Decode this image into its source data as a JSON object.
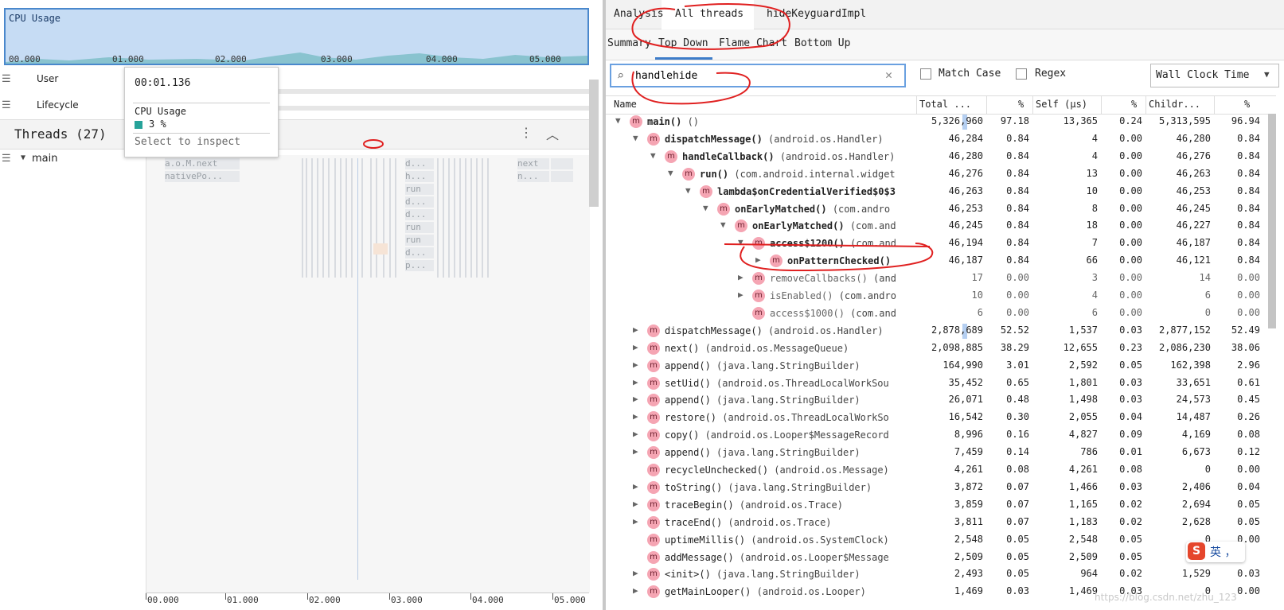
{
  "cpu": {
    "title": "CPU Usage",
    "ticks": [
      "00.000",
      "01.000",
      "02.000",
      "03.000",
      "04.000",
      "05.000"
    ]
  },
  "left_rows": {
    "user": "User",
    "lifecycle": "Lifecycle"
  },
  "threads": {
    "title": "Threads (27)",
    "main_label": "main"
  },
  "tooltip": {
    "time": "00:01.136",
    "label": "CPU Usage",
    "value": "3 %",
    "hint": "Select to inspect"
  },
  "flame": {
    "col1": [
      "a.o.M.next",
      "nativePo..."
    ],
    "col2": [
      "d...",
      "h...",
      "run",
      "d...",
      "d...",
      "run",
      "run",
      "d...",
      "p..."
    ],
    "col3": [
      "next",
      "n..."
    ]
  },
  "ruler": [
    "00.000",
    "01.000",
    "02.000",
    "03.000",
    "04.000",
    "05.000"
  ],
  "tabs": [
    "Analysis",
    "All threads",
    "hideKeyguardImpl"
  ],
  "subtabs": [
    "Summary",
    "Top Down",
    "Flame Chart",
    "Bottom Up"
  ],
  "search": {
    "value": "handlehide"
  },
  "options": {
    "match_case": "Match Case",
    "regex": "Regex",
    "clock": "Wall Clock Time"
  },
  "columns": [
    "Name",
    "Total ...",
    "%",
    "Self (μs)",
    "%",
    "Childr...",
    "%"
  ],
  "rows": [
    {
      "depth": 0,
      "arrow": "down",
      "name": "main()",
      "cls": "()",
      "total": "5,326,960",
      "tp": "97.18",
      "self": "13,365",
      "sp": "0.24",
      "child": "5,313,595",
      "cp": "96.94",
      "bold": true
    },
    {
      "depth": 1,
      "arrow": "down",
      "name": "dispatchMessage()",
      "cls": "(android.os.Handler)",
      "total": "46,284",
      "tp": "0.84",
      "self": "4",
      "sp": "0.00",
      "child": "46,280",
      "cp": "0.84",
      "bold": true
    },
    {
      "depth": 2,
      "arrow": "down",
      "name": "handleCallback()",
      "cls": "(android.os.Handler)",
      "total": "46,280",
      "tp": "0.84",
      "self": "4",
      "sp": "0.00",
      "child": "46,276",
      "cp": "0.84",
      "bold": true
    },
    {
      "depth": 3,
      "arrow": "down",
      "name": "run()",
      "cls": "(com.android.internal.widget",
      "total": "46,276",
      "tp": "0.84",
      "self": "13",
      "sp": "0.00",
      "child": "46,263",
      "cp": "0.84",
      "bold": true
    },
    {
      "depth": 4,
      "arrow": "down",
      "name": "lambda$onCredentialVerified$0$3",
      "cls": "",
      "total": "46,263",
      "tp": "0.84",
      "self": "10",
      "sp": "0.00",
      "child": "46,253",
      "cp": "0.84",
      "bold": true
    },
    {
      "depth": 5,
      "arrow": "down",
      "name": "onEarlyMatched()",
      "cls": "(com.andro",
      "total": "46,253",
      "tp": "0.84",
      "self": "8",
      "sp": "0.00",
      "child": "46,245",
      "cp": "0.84",
      "bold": true
    },
    {
      "depth": 6,
      "arrow": "down",
      "name": "onEarlyMatched()",
      "cls": "(com.and",
      "total": "46,245",
      "tp": "0.84",
      "self": "18",
      "sp": "0.00",
      "child": "46,227",
      "cp": "0.84",
      "bold": true
    },
    {
      "depth": 7,
      "arrow": "down",
      "name": "access$1200()",
      "cls": "(com.and",
      "total": "46,194",
      "tp": "0.84",
      "self": "7",
      "sp": "0.00",
      "child": "46,187",
      "cp": "0.84",
      "bold": true
    },
    {
      "depth": 8,
      "arrow": "right",
      "name": "onPatternChecked()",
      "cls": "",
      "total": "46,187",
      "tp": "0.84",
      "self": "66",
      "sp": "0.00",
      "child": "46,121",
      "cp": "0.84",
      "bold": true
    },
    {
      "depth": 7,
      "arrow": "right",
      "name": "removeCallbacks()",
      "cls": "(and",
      "total": "17",
      "tp": "0.00",
      "self": "3",
      "sp": "0.00",
      "child": "14",
      "cp": "0.00",
      "dim": true
    },
    {
      "depth": 7,
      "arrow": "right",
      "name": "isEnabled()",
      "cls": "(com.andro",
      "total": "10",
      "tp": "0.00",
      "self": "4",
      "sp": "0.00",
      "child": "6",
      "cp": "0.00",
      "dim": true
    },
    {
      "depth": 7,
      "arrow": "none",
      "name": "access$1000()",
      "cls": "(com.and",
      "total": "6",
      "tp": "0.00",
      "self": "6",
      "sp": "0.00",
      "child": "0",
      "cp": "0.00",
      "dim": true
    },
    {
      "depth": 1,
      "arrow": "right",
      "name": "dispatchMessage()",
      "cls": "(android.os.Handler)",
      "total": "2,878,689",
      "tp": "52.52",
      "self": "1,537",
      "sp": "0.03",
      "child": "2,877,152",
      "cp": "52.49"
    },
    {
      "depth": 1,
      "arrow": "right",
      "name": "next()",
      "cls": "(android.os.MessageQueue)",
      "total": "2,098,885",
      "tp": "38.29",
      "self": "12,655",
      "sp": "0.23",
      "child": "2,086,230",
      "cp": "38.06"
    },
    {
      "depth": 1,
      "arrow": "right",
      "name": "append()",
      "cls": "(java.lang.StringBuilder)",
      "total": "164,990",
      "tp": "3.01",
      "self": "2,592",
      "sp": "0.05",
      "child": "162,398",
      "cp": "2.96"
    },
    {
      "depth": 1,
      "arrow": "right",
      "name": "setUid()",
      "cls": "(android.os.ThreadLocalWorkSou",
      "total": "35,452",
      "tp": "0.65",
      "self": "1,801",
      "sp": "0.03",
      "child": "33,651",
      "cp": "0.61"
    },
    {
      "depth": 1,
      "arrow": "right",
      "name": "append()",
      "cls": "(java.lang.StringBuilder)",
      "total": "26,071",
      "tp": "0.48",
      "self": "1,498",
      "sp": "0.03",
      "child": "24,573",
      "cp": "0.45"
    },
    {
      "depth": 1,
      "arrow": "right",
      "name": "restore()",
      "cls": "(android.os.ThreadLocalWorkSo",
      "total": "16,542",
      "tp": "0.30",
      "self": "2,055",
      "sp": "0.04",
      "child": "14,487",
      "cp": "0.26"
    },
    {
      "depth": 1,
      "arrow": "right",
      "name": "copy()",
      "cls": "(android.os.Looper$MessageRecord",
      "total": "8,996",
      "tp": "0.16",
      "self": "4,827",
      "sp": "0.09",
      "child": "4,169",
      "cp": "0.08"
    },
    {
      "depth": 1,
      "arrow": "right",
      "name": "append()",
      "cls": "(java.lang.StringBuilder)",
      "total": "7,459",
      "tp": "0.14",
      "self": "786",
      "sp": "0.01",
      "child": "6,673",
      "cp": "0.12"
    },
    {
      "depth": 1,
      "arrow": "none",
      "name": "recycleUnchecked()",
      "cls": "(android.os.Message)",
      "total": "4,261",
      "tp": "0.08",
      "self": "4,261",
      "sp": "0.08",
      "child": "0",
      "cp": "0.00"
    },
    {
      "depth": 1,
      "arrow": "right",
      "name": "toString()",
      "cls": "(java.lang.StringBuilder)",
      "total": "3,872",
      "tp": "0.07",
      "self": "1,466",
      "sp": "0.03",
      "child": "2,406",
      "cp": "0.04"
    },
    {
      "depth": 1,
      "arrow": "right",
      "name": "traceBegin()",
      "cls": "(android.os.Trace)",
      "total": "3,859",
      "tp": "0.07",
      "self": "1,165",
      "sp": "0.02",
      "child": "2,694",
      "cp": "0.05"
    },
    {
      "depth": 1,
      "arrow": "right",
      "name": "traceEnd()",
      "cls": "(android.os.Trace)",
      "total": "3,811",
      "tp": "0.07",
      "self": "1,183",
      "sp": "0.02",
      "child": "2,628",
      "cp": "0.05"
    },
    {
      "depth": 1,
      "arrow": "none",
      "name": "uptimeMillis()",
      "cls": "(android.os.SystemClock)",
      "total": "2,548",
      "tp": "0.05",
      "self": "2,548",
      "sp": "0.05",
      "child": "0",
      "cp": "0.00"
    },
    {
      "depth": 1,
      "arrow": "none",
      "name": "addMessage()",
      "cls": "(android.os.Looper$Message",
      "total": "2,509",
      "tp": "0.05",
      "self": "2,509",
      "sp": "0.05",
      "child": "",
      "cp": ""
    },
    {
      "depth": 1,
      "arrow": "right",
      "name": "<init>()",
      "cls": "(java.lang.StringBuilder)",
      "total": "2,493",
      "tp": "0.05",
      "self": "964",
      "sp": "0.02",
      "child": "1,529",
      "cp": "0.03"
    },
    {
      "depth": 1,
      "arrow": "right",
      "name": "getMainLooper()",
      "cls": "(android.os.Looper)",
      "total": "1,469",
      "tp": "0.03",
      "self": "1,469",
      "sp": "0.03",
      "child": "0",
      "cp": "0.00"
    }
  ],
  "ime": {
    "logo": "S",
    "text": "英 ，"
  },
  "watermark": "https://blog.csdn.net/zhu_123"
}
